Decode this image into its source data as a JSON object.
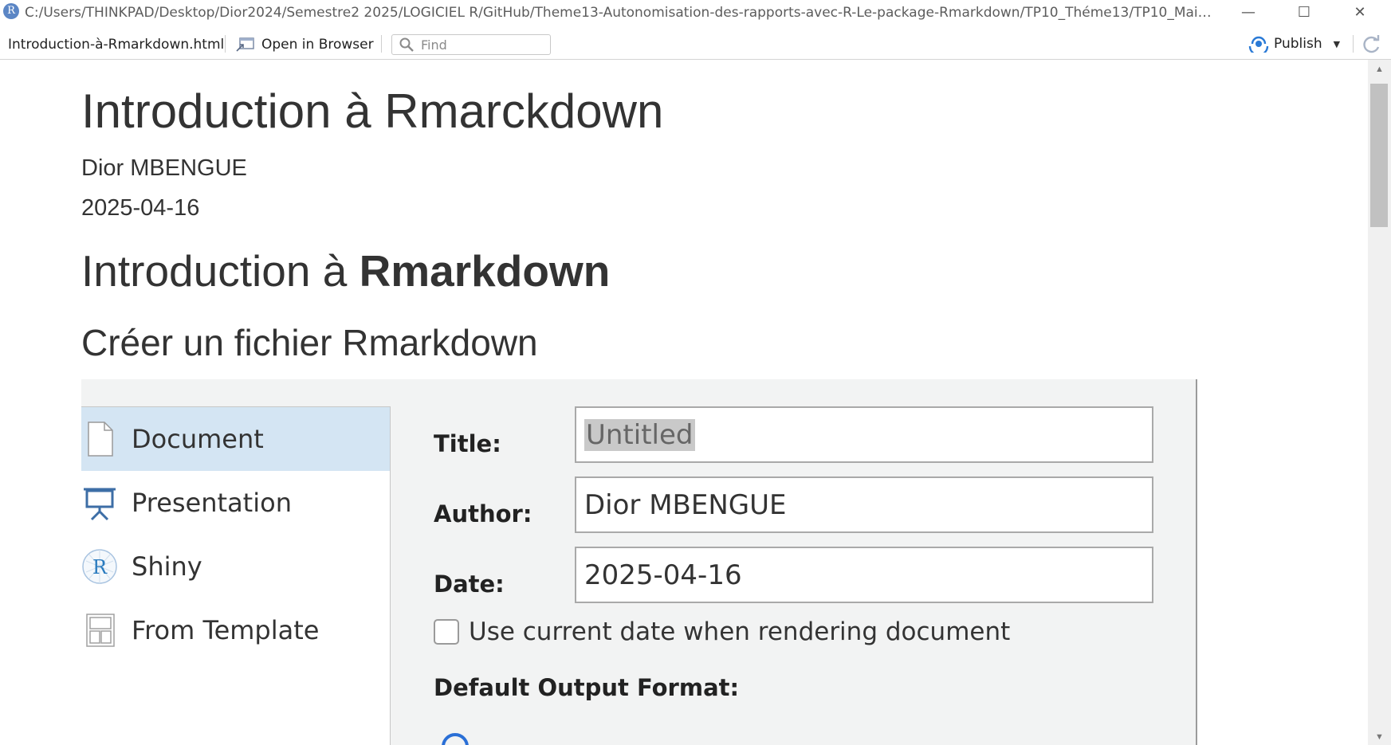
{
  "window": {
    "app_icon_letter": "R",
    "title_path": "C:/Users/THINKPAD/Desktop/Dior2024/Semestre2 2025/LOGICIEL R/GitHub/Theme13-Autonomisation-des-rapports-avec-R-Le-package-Rmarkdown/TP10_Théme13/TP10_Maison/debut..."
  },
  "toolbar": {
    "file_name": "Introduction-à-Rmarkdown.html",
    "open_in_browser": "Open in Browser",
    "find_placeholder": "Find",
    "publish": "Publish"
  },
  "document": {
    "title": "Introduction à Rmarckdown",
    "author": "Dior MBENGUE",
    "date": "2025-04-16",
    "section1_prefix": "Introduction à ",
    "section1_bold": "Rmarkdown",
    "section2": "Créer un fichier Rmarkdown"
  },
  "dialog": {
    "sidebar": [
      {
        "label": "Document",
        "icon": "document-icon"
      },
      {
        "label": "Presentation",
        "icon": "presentation-icon"
      },
      {
        "label": "Shiny",
        "icon": "shiny-icon"
      },
      {
        "label": "From Template",
        "icon": "template-icon"
      }
    ],
    "title_label": "Title:",
    "title_value": "Untitled",
    "author_label": "Author:",
    "author_value": "Dior MBENGUE",
    "date_label": "Date:",
    "date_value": "2025-04-16",
    "use_current_date": "Use current date when rendering document",
    "default_output_format": "Default Output Format:"
  },
  "colors": {
    "sidebar_active": "#d4e5f3",
    "publish_icon": "#2a7ad6",
    "radio": "#2a6fd6"
  }
}
